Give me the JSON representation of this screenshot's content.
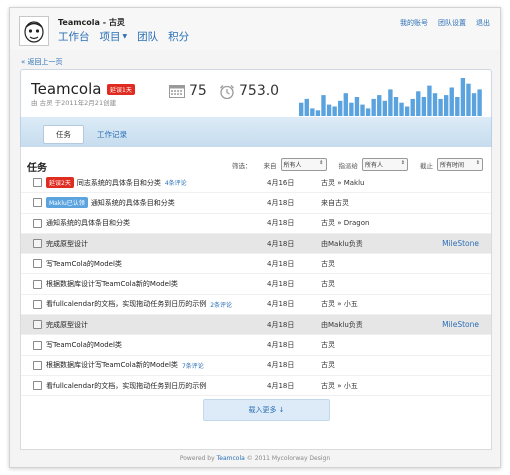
{
  "header": {
    "brand": "Teamcola - 古灵",
    "nav": [
      {
        "label": "工作台",
        "dropdown": false
      },
      {
        "label": "项目",
        "dropdown": true
      },
      {
        "label": "团队",
        "dropdown": false
      },
      {
        "label": "积分",
        "dropdown": false
      }
    ],
    "links": [
      "我的账号",
      "团队设置",
      "退出"
    ]
  },
  "back_link": "« 返回上一页",
  "project": {
    "name": "Teamcola",
    "late_badge": "延误1天",
    "meta": "由 古灵 于2011年2月21创建",
    "stat_tasks": "75",
    "stat_hours": "753.0",
    "activity_bars": [
      0.35,
      0.45,
      0.2,
      0.15,
      0.55,
      0.3,
      0.25,
      0.4,
      0.6,
      0.35,
      0.5,
      0.3,
      0.2,
      0.45,
      0.55,
      0.4,
      0.7,
      0.5,
      0.35,
      0.25,
      0.45,
      0.65,
      0.5,
      0.8,
      0.6,
      0.45,
      0.55,
      0.75,
      0.5,
      1.0,
      0.85,
      0.6,
      0.7
    ],
    "bar_color": "#5aa3df"
  },
  "tabs": [
    {
      "label": "任务",
      "active": true
    },
    {
      "label": "工作记录",
      "active": false
    }
  ],
  "tasks_section": {
    "title": "任务",
    "filter_label": "筛选：",
    "from_label": "来自",
    "from_value": "所有人",
    "assign_label": "指派给",
    "assign_value": "所有人",
    "due_label": "截止",
    "due_value": "所有时间"
  },
  "rows": [
    {
      "type": "task",
      "tag": "延误2天",
      "tag_color": "red",
      "title": "同志系统的具体条目和分类",
      "comment": "4条评论",
      "date": "4月16日",
      "who": "古灵 » Maklu"
    },
    {
      "type": "task",
      "tag": "Maklu已认领",
      "tag_color": "blue",
      "title": "通知系统的具体条目和分类",
      "comment": "",
      "date": "4月18日",
      "who": "来自古灵"
    },
    {
      "type": "task",
      "tag": "",
      "tag_color": "",
      "title": "通知系统的具体条目和分类",
      "comment": "",
      "date": "4月18日",
      "who": "古灵 » Dragon"
    },
    {
      "type": "milestone",
      "title": "完成原型设计",
      "date": "4月18日",
      "who": "由Maklu负责",
      "ms": "MileStone"
    },
    {
      "type": "task",
      "tag": "",
      "tag_color": "",
      "title": "写TeamCola的Model类",
      "comment": "",
      "date": "4月18日",
      "who": "古灵"
    },
    {
      "type": "task",
      "tag": "",
      "tag_color": "",
      "title": "根据数据库设计写TeamCola新的Model类",
      "comment": "",
      "date": "4月18日",
      "who": "古灵"
    },
    {
      "type": "task",
      "tag": "",
      "tag_color": "",
      "title": "看fullcalendar的文档，实现拖动任务到日历的示例",
      "comment": "2条评论",
      "date": "4月18日",
      "who": "古灵 » 小五"
    },
    {
      "type": "milestone",
      "title": "完成原型设计",
      "date": "4月18日",
      "who": "由Maklu负责",
      "ms": "MileStone"
    },
    {
      "type": "task",
      "tag": "",
      "tag_color": "",
      "title": "写TeamCola的Model类",
      "comment": "",
      "date": "4月18日",
      "who": "古灵"
    },
    {
      "type": "task",
      "tag": "",
      "tag_color": "",
      "title": "根据数据库设计写TeamCola新的Model类",
      "comment": "7条评论",
      "date": "4月18日",
      "who": "古灵"
    },
    {
      "type": "task",
      "tag": "",
      "tag_color": "",
      "title": "看fullcalendar的文档，实现拖动任务到日历的示例",
      "comment": "",
      "date": "4月18日",
      "who": "古灵 » 小五"
    }
  ],
  "load_more": "载入更多 ↓",
  "footer": {
    "prefix": "Powered by",
    "link": "Teamcola",
    "suffix": "© 2011 Mycolorway Design"
  }
}
